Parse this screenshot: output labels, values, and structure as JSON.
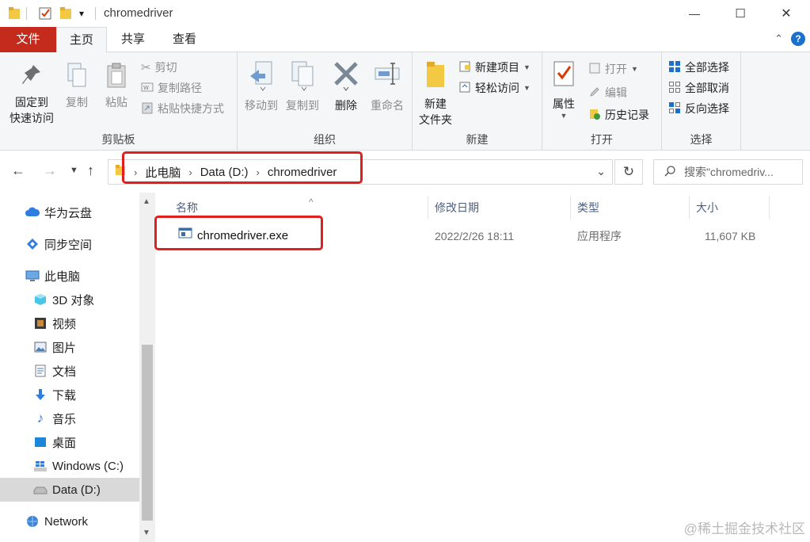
{
  "window": {
    "title": "chromedriver",
    "quick_access_caret": "▾",
    "controls": {
      "minimize": "—",
      "maximize": "☐",
      "close": "✕"
    }
  },
  "ribbon_tabs": {
    "file": "文件",
    "home": "主页",
    "share": "共享",
    "view": "查看",
    "collapse_caret": "⌃",
    "help": "?"
  },
  "ribbon": {
    "clipboard": {
      "label": "剪贴板",
      "pin_line1": "固定到",
      "pin_line2": "快速访问",
      "copy": "复制",
      "paste": "粘贴",
      "cut": "剪切",
      "copy_path": "复制路径",
      "paste_shortcut": "粘贴快捷方式"
    },
    "organize": {
      "label": "组织",
      "move_to": "移动到",
      "copy_to": "复制到",
      "delete": "删除",
      "rename": "重命名"
    },
    "new": {
      "label": "新建",
      "new_folder_line1": "新建",
      "new_folder_line2": "文件夹",
      "new_item": "新建项目",
      "easy_access": "轻松访问"
    },
    "open": {
      "label": "打开",
      "properties": "属性",
      "open": "打开",
      "edit": "编辑",
      "history": "历史记录"
    },
    "select": {
      "label": "选择",
      "select_all": "全部选择",
      "select_none": "全部取消",
      "invert": "反向选择"
    }
  },
  "address": {
    "crumbs": [
      "此电脑",
      "Data (D:)",
      "chromedriver"
    ],
    "separator": "›",
    "search_placeholder": "搜索\"chromedriv..."
  },
  "sidebar": {
    "items": [
      {
        "label": "华为云盘",
        "icon": "cloud-icon"
      },
      {
        "label": "同步空间",
        "icon": "sync-space-icon"
      },
      {
        "label": "此电脑",
        "icon": "computer-icon"
      },
      {
        "label": "3D 对象",
        "icon": "cube-3d-icon"
      },
      {
        "label": "视频",
        "icon": "video-icon"
      },
      {
        "label": "图片",
        "icon": "pictures-icon"
      },
      {
        "label": "文档",
        "icon": "documents-icon"
      },
      {
        "label": "下载",
        "icon": "download-icon"
      },
      {
        "label": "音乐",
        "icon": "music-icon"
      },
      {
        "label": "桌面",
        "icon": "desktop-icon"
      },
      {
        "label": "Windows (C:)",
        "icon": "windows-drive-icon"
      },
      {
        "label": "Data (D:)",
        "icon": "drive-icon",
        "selected": true
      },
      {
        "label": "Network",
        "icon": "network-icon"
      }
    ]
  },
  "file_list": {
    "columns": {
      "name": "名称",
      "modified": "修改日期",
      "type": "类型",
      "size": "大小"
    },
    "sort_arrow": "^",
    "rows": [
      {
        "name": "chromedriver.exe",
        "modified": "2022/2/26 18:11",
        "type": "应用程序",
        "size": "11,607 KB"
      }
    ]
  },
  "watermark": "@稀土掘金技术社区",
  "colors": {
    "accent_red": "#c42b1c",
    "highlight_box": "#e0201c",
    "selection": "#d9d9d9"
  }
}
